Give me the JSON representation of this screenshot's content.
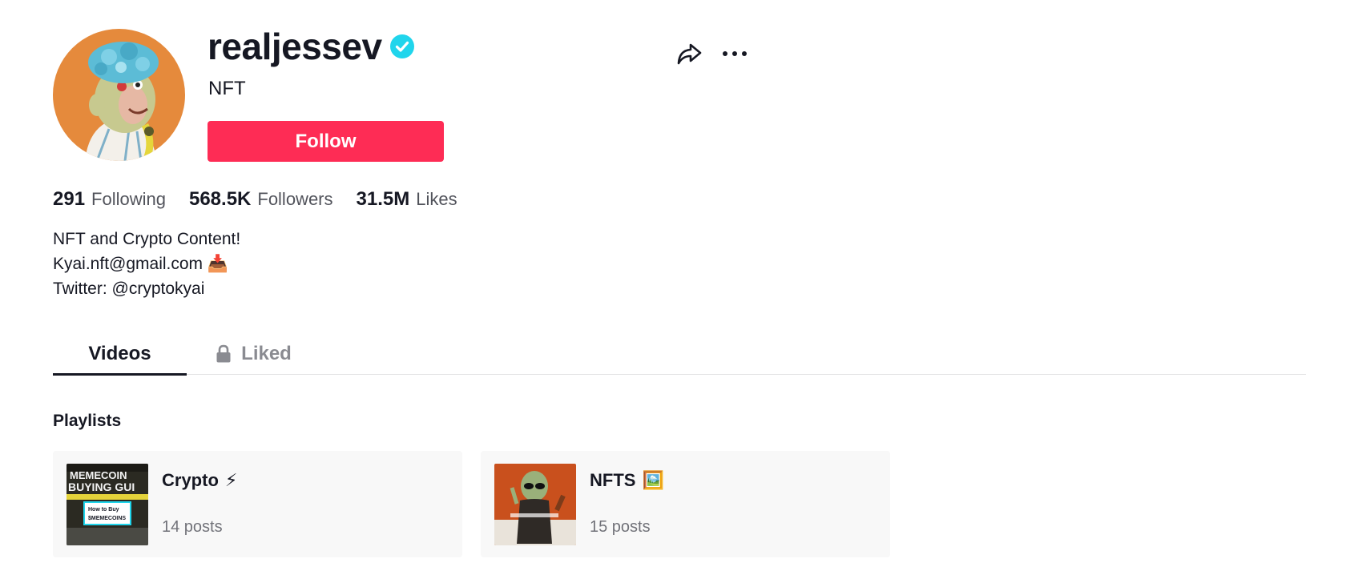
{
  "profile": {
    "username": "realjessev",
    "verified": true,
    "display_name": "NFT",
    "follow_label": "Follow",
    "avatar_icon": "ape-avatar"
  },
  "header_actions": {
    "share_icon": "share-icon",
    "more_icon": "more-icon"
  },
  "stats": [
    {
      "value": "291",
      "label": "Following"
    },
    {
      "value": "568.5K",
      "label": "Followers"
    },
    {
      "value": "31.5M",
      "label": "Likes"
    }
  ],
  "bio": {
    "line1": "NFT and Crypto Content!",
    "line2": "Kyai.nft@gmail.com 📥",
    "line3": "Twitter: @cryptokyai"
  },
  "tabs": [
    {
      "label": "Videos",
      "active": true
    },
    {
      "label": "Liked",
      "active": false,
      "locked": true
    }
  ],
  "playlists": {
    "title": "Playlists",
    "items": [
      {
        "name": "Crypto",
        "emoji": "⚡",
        "count": "14 posts",
        "thumb_text": "MEMECOIN BUYING GUI",
        "thumb_sub": "How to Buy $MEMECOINS"
      },
      {
        "name": "NFTS",
        "emoji": "🖼️",
        "count": "15 posts"
      }
    ]
  },
  "colors": {
    "accent": "#fe2c55",
    "verified": "#20d5ec",
    "text": "#161823"
  }
}
